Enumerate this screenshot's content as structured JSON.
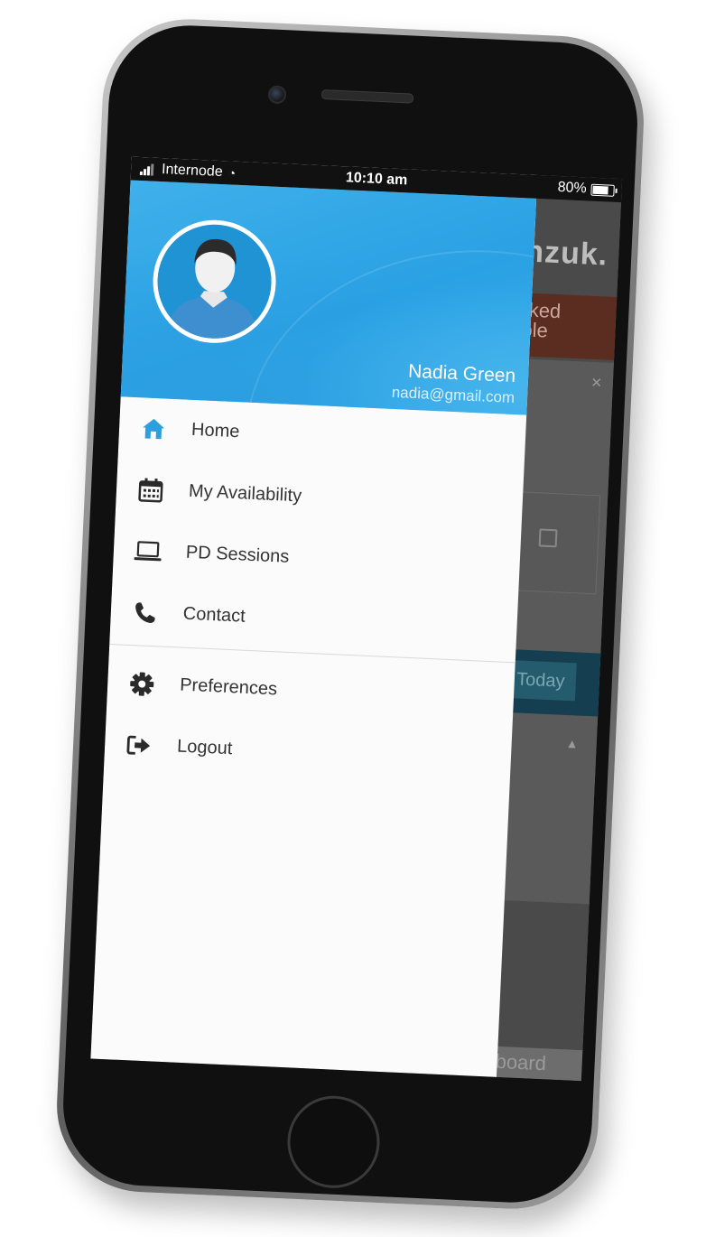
{
  "status_bar": {
    "carrier": "Internode",
    "time": "10:10 am",
    "battery_percent": "80%",
    "battery_level": 0.8
  },
  "background_app": {
    "brand": "nzuk.",
    "banner_text": "rked\nole",
    "close_glyph": "×",
    "today_label": "Today",
    "caret_glyph": "▲",
    "bottom_label": "board"
  },
  "drawer": {
    "user": {
      "name": "Nadia Green",
      "email": "nadia@gmail.com"
    },
    "menu": [
      {
        "label": "Home",
        "icon": "home-icon"
      },
      {
        "label": "My Availability",
        "icon": "calendar-icon"
      },
      {
        "label": "PD Sessions",
        "icon": "laptop-icon"
      },
      {
        "label": "Contact",
        "icon": "phone-icon"
      }
    ],
    "menu_secondary": [
      {
        "label": "Preferences",
        "icon": "gear-icon"
      },
      {
        "label": "Logout",
        "icon": "logout-icon"
      }
    ]
  },
  "colors": {
    "header_blue": "#2aa1e4",
    "home_icon": "#2d9fdd",
    "drawer_bg": "#fbfbfb",
    "overlay_dim": "#4a4a4a",
    "brand_accent": "#5b2d20",
    "today_accent": "#245b6d"
  }
}
